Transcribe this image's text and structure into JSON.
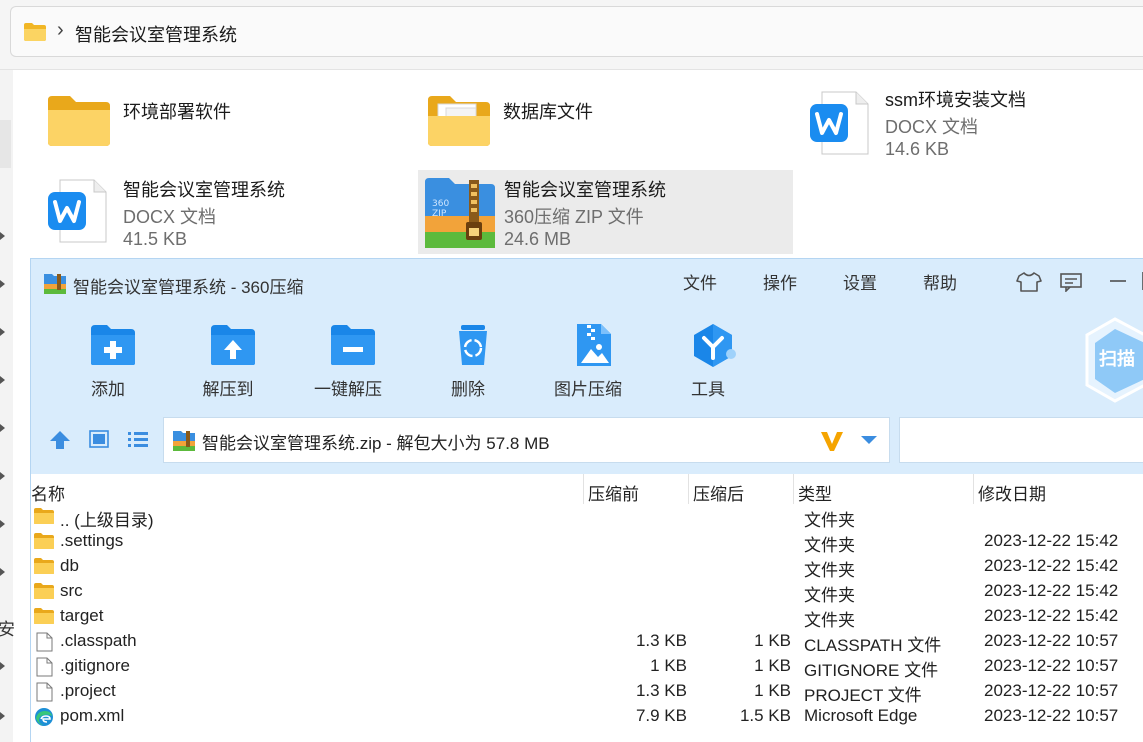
{
  "explorer": {
    "breadcrumb": "智能会议室管理系统",
    "nav_stub_text": "安",
    "items": [
      {
        "name": "环境部署软件",
        "type": "",
        "size": ""
      },
      {
        "name": "数据库文件",
        "type": "",
        "size": ""
      },
      {
        "name": "ssm环境安装文档",
        "type": "DOCX 文档",
        "size": "14.6 KB"
      },
      {
        "name": "智能会议室管理系统",
        "type": "DOCX 文档",
        "size": "41.5 KB"
      },
      {
        "name": "智能会议室管理系统",
        "type": "360压缩 ZIP 文件",
        "size": "24.6 MB"
      }
    ]
  },
  "zip_window": {
    "title": "智能会议室管理系统 - 360压缩",
    "menu": [
      "文件",
      "操作",
      "设置",
      "帮助"
    ],
    "toolbar": [
      "添加",
      "解压到",
      "一键解压",
      "删除",
      "图片压缩",
      "工具"
    ],
    "scan_label": "扫描",
    "path": "智能会议室管理系统.zip - 解包大小为 57.8 MB",
    "columns": [
      "名称",
      "压缩前",
      "压缩后",
      "类型",
      "修改日期"
    ],
    "rows": [
      {
        "name": ".. (上级目录)",
        "before": "",
        "after": "",
        "type": "文件夹",
        "date": "",
        "icon": "folder-icon"
      },
      {
        "name": ".settings",
        "before": "",
        "after": "",
        "type": "文件夹",
        "date": "2023-12-22 15:42",
        "icon": "folder-icon"
      },
      {
        "name": "db",
        "before": "",
        "after": "",
        "type": "文件夹",
        "date": "2023-12-22 15:42",
        "icon": "folder-icon"
      },
      {
        "name": "src",
        "before": "",
        "after": "",
        "type": "文件夹",
        "date": "2023-12-22 15:42",
        "icon": "folder-icon"
      },
      {
        "name": "target",
        "before": "",
        "after": "",
        "type": "文件夹",
        "date": "2023-12-22 15:42",
        "icon": "folder-icon"
      },
      {
        "name": ".classpath",
        "before": "1.3 KB",
        "after": "1 KB",
        "type": "CLASSPATH 文件",
        "date": "2023-12-22 10:57",
        "icon": "file-icon"
      },
      {
        "name": ".gitignore",
        "before": "1 KB",
        "after": "1 KB",
        "type": "GITIGNORE 文件",
        "date": "2023-12-22 10:57",
        "icon": "file-icon"
      },
      {
        "name": ".project",
        "before": "1.3 KB",
        "after": "1 KB",
        "type": "PROJECT 文件",
        "date": "2023-12-22 10:57",
        "icon": "file-icon"
      },
      {
        "name": "pom.xml",
        "before": "7.9 KB",
        "after": "1.5 KB",
        "type": "Microsoft Edge",
        "date": "2023-12-22 10:57",
        "icon": "edge-icon"
      }
    ]
  },
  "colors": {
    "accent": "#1a8cf0",
    "window_bg": "#d9ecfc",
    "folder": "#f8c843"
  }
}
